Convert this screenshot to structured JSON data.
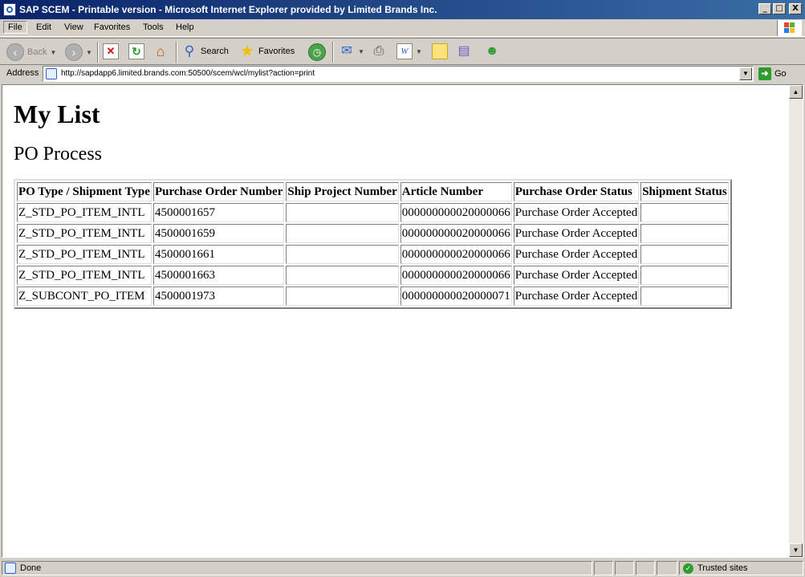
{
  "window": {
    "title": "SAP SCEM - Printable version - Microsoft Internet Explorer provided by Limited Brands Inc.",
    "buttons": {
      "minimize": "_",
      "maximize": "□",
      "close": "X"
    }
  },
  "menu": [
    "File",
    "Edit",
    "View",
    "Favorites",
    "Tools",
    "Help"
  ],
  "toolbar": {
    "back_label": "Back",
    "search_label": "Search",
    "favorites_label": "Favorites"
  },
  "address": {
    "label": "Address",
    "url": "http://sapdapp6.limited.brands.com:50500/scem/wcl/mylist?action=print",
    "go_label": "Go"
  },
  "page": {
    "heading": "My List",
    "subheading": "PO Process",
    "table": {
      "headers": [
        "PO Type / Shipment Type",
        "Purchase Order Number",
        "Ship Project Number",
        "Article Number",
        "Purchase Order Status",
        "Shipment Status"
      ],
      "rows": [
        [
          "Z_STD_PO_ITEM_INTL",
          "4500001657",
          "",
          "000000000020000066",
          "Purchase Order Accepted",
          ""
        ],
        [
          "Z_STD_PO_ITEM_INTL",
          "4500001659",
          "",
          "000000000020000066",
          "Purchase Order Accepted",
          ""
        ],
        [
          "Z_STD_PO_ITEM_INTL",
          "4500001661",
          "",
          "000000000020000066",
          "Purchase Order Accepted",
          ""
        ],
        [
          "Z_STD_PO_ITEM_INTL",
          "4500001663",
          "",
          "000000000020000066",
          "Purchase Order Accepted",
          ""
        ],
        [
          "Z_SUBCONT_PO_ITEM",
          "4500001973",
          "",
          "000000000020000071",
          "Purchase Order Accepted",
          ""
        ]
      ]
    }
  },
  "status": {
    "text": "Done",
    "zone": "Trusted sites"
  },
  "colors": {
    "titlebar": "#0a246a",
    "chrome": "#d4d0c8"
  }
}
